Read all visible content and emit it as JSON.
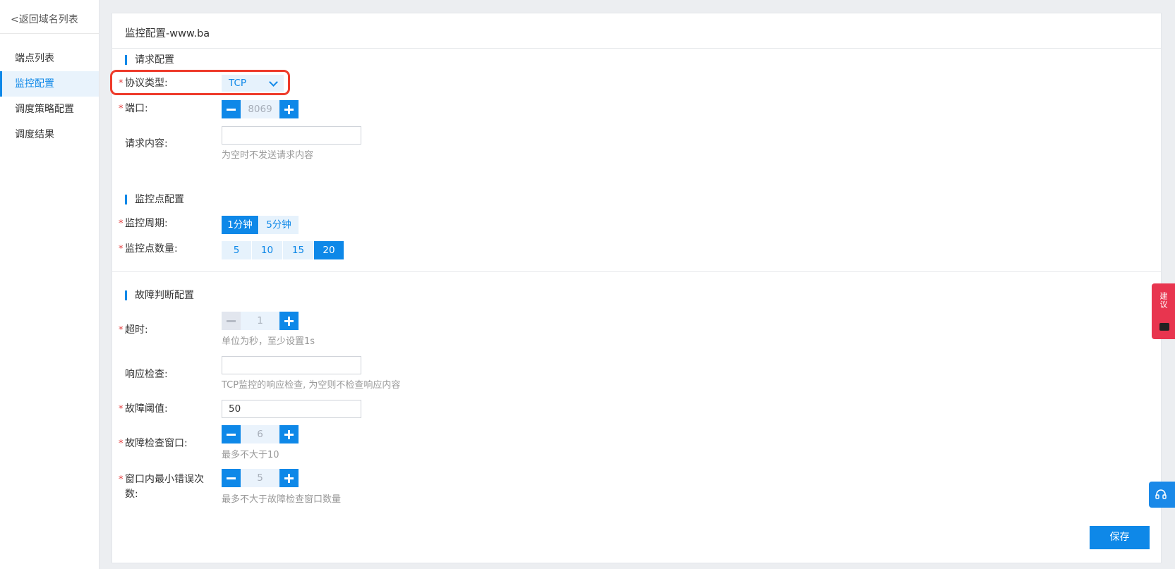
{
  "sidebar": {
    "back_label": "<返回域名列表",
    "items": [
      {
        "label": "端点列表"
      },
      {
        "label": "监控配置",
        "active": true
      },
      {
        "label": "调度策略配置"
      },
      {
        "label": "调度结果"
      }
    ]
  },
  "page": {
    "title": "监控配置-www.ba"
  },
  "request_section": {
    "title": "请求配置",
    "protocol": {
      "label": "协议类型:",
      "value": "TCP"
    },
    "port": {
      "label": "端口:",
      "value": "8069"
    },
    "content": {
      "label": "请求内容:",
      "value": "",
      "hint": "为空时不发送请求内容"
    }
  },
  "monitor_section": {
    "title": "监控点配置",
    "period": {
      "label": "监控周期:",
      "options": [
        "1分钟",
        "5分钟"
      ],
      "selected": "1分钟"
    },
    "count": {
      "label": "监控点数量:",
      "options": [
        "5",
        "10",
        "15",
        "20"
      ],
      "selected": "20"
    }
  },
  "fault_section": {
    "title": "故障判断配置",
    "timeout": {
      "label": "超时:",
      "value": "1",
      "hint": "单位为秒，至少设置1s"
    },
    "response_check": {
      "label": "响应检查:",
      "value": "",
      "hint": "TCP监控的响应检查, 为空则不检查响应内容"
    },
    "threshold": {
      "label": "故障阈值:",
      "value": "50"
    },
    "window": {
      "label": "故障检查窗口:",
      "value": "6",
      "hint": "最多不大于10"
    },
    "min_errors": {
      "label_line1": "窗口内最小错误次",
      "label_line2": "数:",
      "value": "5",
      "hint": "最多不大于故障检查窗口数量"
    }
  },
  "actions": {
    "save_label": "保存"
  },
  "floating": {
    "feedback_label": "建议",
    "support_icon": "headset-icon"
  },
  "colors": {
    "accent": "#0e88e8",
    "highlight": "#ee3b2b",
    "required": "#e23b3b",
    "feedback": "#e8354f"
  }
}
